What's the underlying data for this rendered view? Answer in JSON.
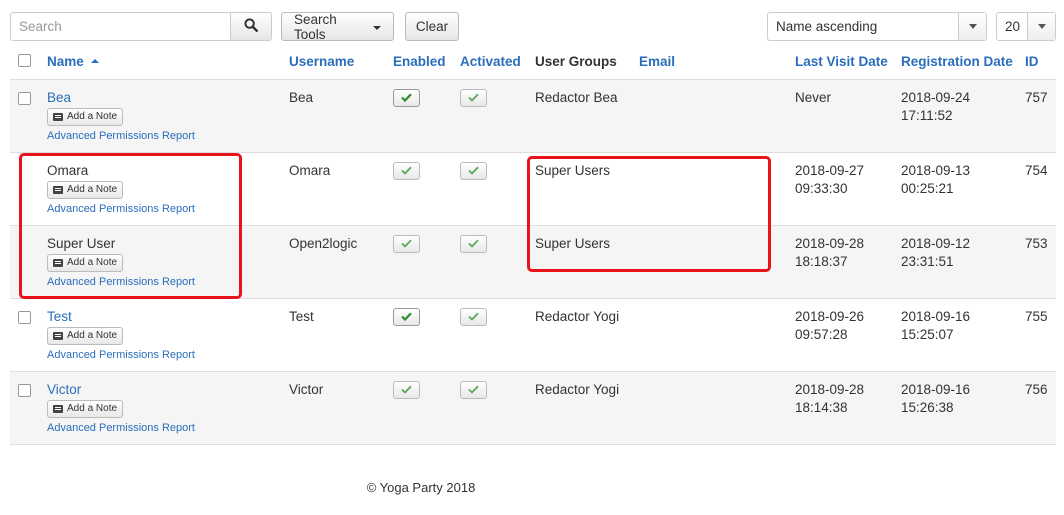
{
  "search": {
    "placeholder": "Search",
    "value": ""
  },
  "toolbar": {
    "search_tools_label": "Search Tools",
    "clear_label": "Clear",
    "sort_value": "Name ascending",
    "limit_value": "20"
  },
  "columns": {
    "name": "Name",
    "username": "Username",
    "enabled": "Enabled",
    "activated": "Activated",
    "user_groups": "User Groups",
    "email": "Email",
    "last_visit": "Last Visit Date",
    "registration": "Registration Date",
    "id": "ID"
  },
  "row_actions": {
    "add_note": "Add a Note",
    "permissions": "Advanced Permissions Report"
  },
  "users": [
    {
      "name": "Bea",
      "username": "Bea",
      "groups": "Redactor Bea",
      "email": "",
      "last_visit_date": "Never",
      "last_visit_time": "",
      "reg_date": "2018-09-24",
      "reg_time": "17:11:52",
      "id": "757"
    },
    {
      "name": "Omara",
      "username": "Omara",
      "groups": "Super Users",
      "email": "",
      "last_visit_date": "2018-09-27",
      "last_visit_time": "09:33:30",
      "reg_date": "2018-09-13",
      "reg_time": "00:25:21",
      "id": "754"
    },
    {
      "name": "Super User",
      "username": "Open2logic",
      "groups": "Super Users",
      "email": "",
      "last_visit_date": "2018-09-28",
      "last_visit_time": "18:18:37",
      "reg_date": "2018-09-12",
      "reg_time": "23:31:51",
      "id": "753"
    },
    {
      "name": "Test",
      "username": "Test",
      "groups": "Redactor Yogi",
      "email": "",
      "last_visit_date": "2018-09-26",
      "last_visit_time": "09:57:28",
      "reg_date": "2018-09-16",
      "reg_time": "15:25:07",
      "id": "755"
    },
    {
      "name": "Victor",
      "username": "Victor",
      "groups": "Redactor Yogi",
      "email": "",
      "last_visit_date": "2018-09-28",
      "last_visit_time": "18:14:38",
      "reg_date": "2018-09-16",
      "reg_time": "15:26:38",
      "id": "756"
    }
  ],
  "footer": {
    "text": "© Yoga Party 2018"
  },
  "colors": {
    "link": "#2a6ebb",
    "check_green": "#3c9a3c",
    "highlight": "#e8141b",
    "row_stripe": "#f5f5f5"
  },
  "icons": [
    "search-icon",
    "caret-down-icon",
    "note-icon",
    "check-icon",
    "sort-asc-icon"
  ]
}
